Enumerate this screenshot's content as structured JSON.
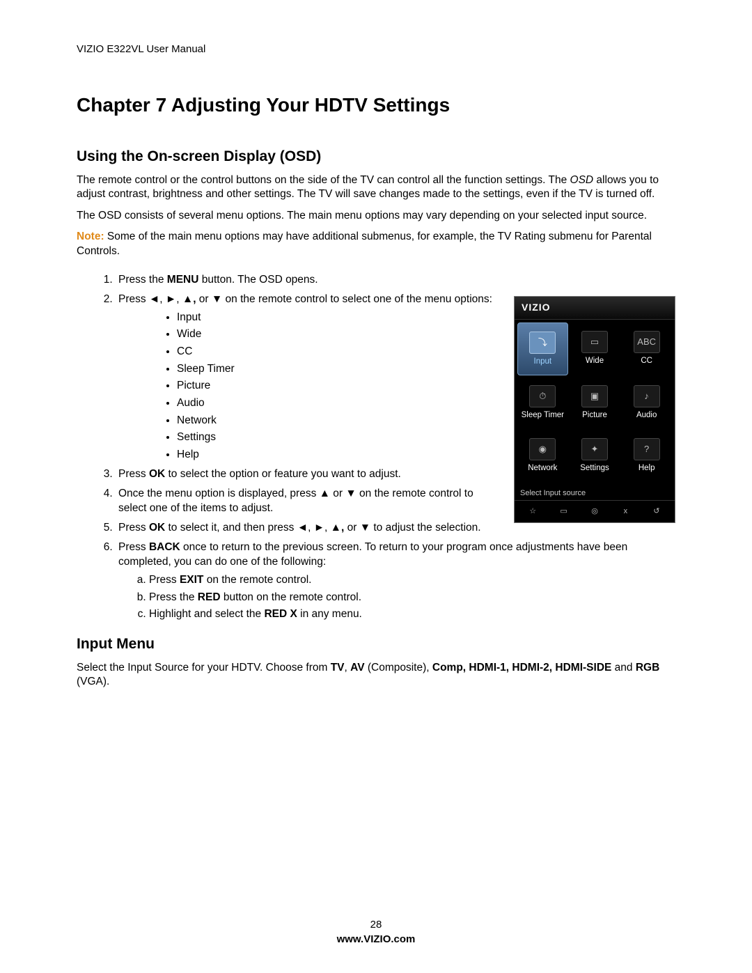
{
  "doc_header": "VIZIO E322VL User Manual",
  "chapter_title": "Chapter 7 Adjusting Your HDTV Settings",
  "section1_title": "Using the On-screen Display (OSD)",
  "para1_a": "The remote control or the control buttons on the side of the TV can control all the function settings. The ",
  "para1_em": "OSD",
  "para1_b": " allows you to adjust contrast, brightness and other settings. The TV will save changes made to the settings, even if the TV is turned off.",
  "para2": "The OSD consists of several menu options. The main menu options may vary depending on your selected input source.",
  "note_label": "Note:",
  "note_text": "  Some of the main menu options may have additional submenus, for example, the TV Rating submenu for Parental Controls.",
  "step1_a": "Press the ",
  "step1_bold": "MENU",
  "step1_b": " button. The OSD opens.",
  "step2_a": "Press ◄, ►, ▲",
  "step2_comma": ",",
  "step2_b": " or ▼ on the remote control to select one of the menu options:",
  "bullets": [
    "Input",
    "Wide",
    "CC",
    "Sleep Timer",
    "Picture",
    "Audio",
    "Network",
    "Settings",
    "Help"
  ],
  "step3_a": "Press ",
  "step3_bold": "OK",
  "step3_b": " to select the option or feature you want to adjust.",
  "step4": "Once the menu option is displayed, press ▲ or ▼ on the remote control to select one of the items to adjust.",
  "step5_a": "Press ",
  "step5_bold": "OK",
  "step5_b": " to select it, and then press ◄, ►, ▲",
  "step5_comma": ",",
  "step5_c": " or ▼ to adjust the selection.",
  "step6_a": "Press ",
  "step6_bold": "BACK",
  "step6_b": " once to return to the previous screen. To return to your program once adjustments have been completed, you can do one of the following:",
  "sub_a_a": "Press ",
  "sub_a_bold": "EXIT",
  "sub_a_b": " on the remote control.",
  "sub_b_a": "Press the ",
  "sub_b_bold": "RED",
  "sub_b_b": " button on the remote control.",
  "sub_c_a": "Highlight and select the ",
  "sub_c_bold": "RED X",
  "sub_c_b": " in any menu.",
  "section2_title": "Input Menu",
  "input_a": "Select the Input Source for your HDTV. Choose from ",
  "input_b1": "TV",
  "input_t1": ", ",
  "input_b2": "AV",
  "input_t2": " (Composite), ",
  "input_b3": "Comp, HDMI-1, HDMI-2, HDMI-SIDE",
  "input_t3": " and ",
  "input_b4": "RGB",
  "input_t4": " (VGA).",
  "osd_brand": "VIZIO",
  "osd_items": [
    {
      "label": "Input",
      "glyph": "⤵",
      "selected": true
    },
    {
      "label": "Wide",
      "glyph": "▭",
      "selected": false
    },
    {
      "label": "CC",
      "glyph": "ABC",
      "selected": false
    },
    {
      "label": "Sleep Timer",
      "glyph": "⏱",
      "selected": false
    },
    {
      "label": "Picture",
      "glyph": "▣",
      "selected": false
    },
    {
      "label": "Audio",
      "glyph": "♪",
      "selected": false
    },
    {
      "label": "Network",
      "glyph": "◉",
      "selected": false
    },
    {
      "label": "Settings",
      "glyph": "✦",
      "selected": false
    },
    {
      "label": "Help",
      "glyph": "?",
      "selected": false
    }
  ],
  "osd_hint": "Select Input source",
  "osd_bottom": [
    "☆",
    "▭",
    "◎",
    "x",
    "↺"
  ],
  "page_number": "28",
  "footer_url": "www.VIZIO.com"
}
